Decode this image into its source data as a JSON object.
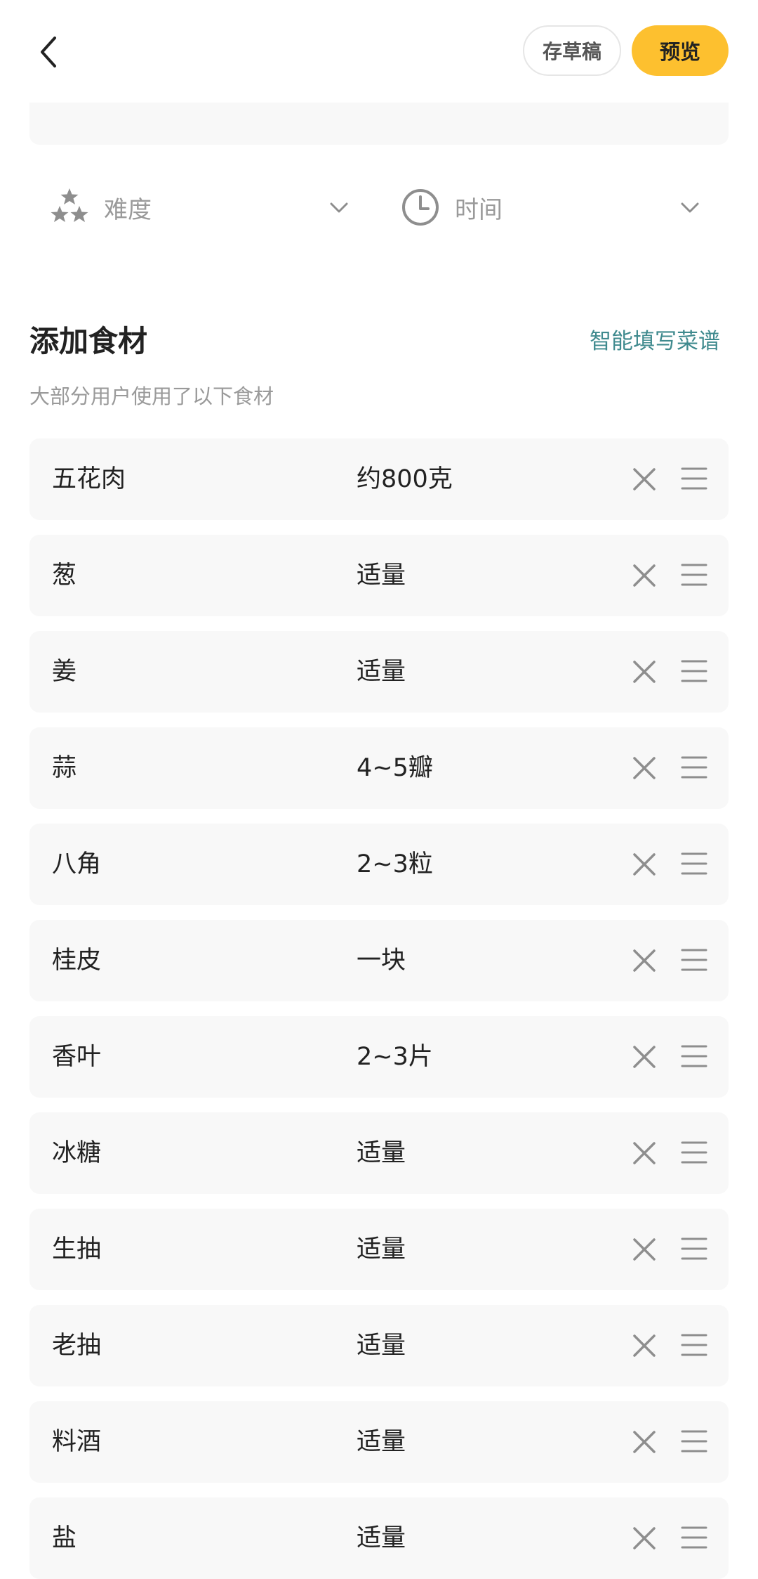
{
  "header": {
    "back_icon": "chevron-left-icon",
    "draft_label": "存草稿",
    "preview_label": "预览",
    "accent_color": "#fdc02f"
  },
  "meta": {
    "difficulty_label": "难度",
    "difficulty_icon": "stars-icon",
    "time_label": "时间",
    "time_icon": "clock-icon"
  },
  "ingredients": {
    "title": "添加食材",
    "smart_fill": "智能填写菜谱",
    "hint": "大部分用户使用了以下食材",
    "link_color": "#3f8a8e",
    "items": [
      {
        "name": "五花肉",
        "amount": "约800克"
      },
      {
        "name": "葱",
        "amount": "适量"
      },
      {
        "name": "姜",
        "amount": "适量"
      },
      {
        "name": "蒜",
        "amount": "4~5瓣"
      },
      {
        "name": "八角",
        "amount": "2~3粒"
      },
      {
        "name": "桂皮",
        "amount": "一块"
      },
      {
        "name": "香叶",
        "amount": "2~3片"
      },
      {
        "name": "冰糖",
        "amount": "适量"
      },
      {
        "name": "生抽",
        "amount": "适量"
      },
      {
        "name": "老抽",
        "amount": "适量"
      },
      {
        "name": "料酒",
        "amount": "适量"
      },
      {
        "name": "盐",
        "amount": "适量"
      }
    ]
  }
}
